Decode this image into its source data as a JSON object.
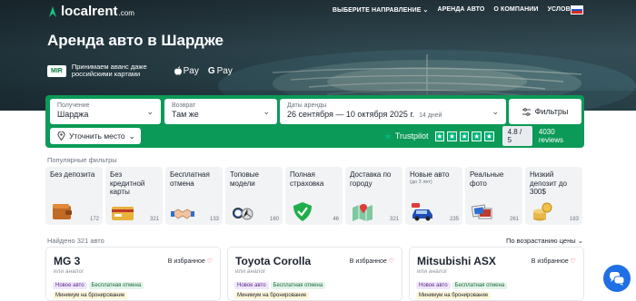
{
  "header": {
    "logo_text": "localrent",
    "logo_domain": ".com",
    "nav": [
      "ВЫБЕРИТЕ НАПРАВЛЕНИЕ ⌄",
      "АРЕНДА АВТО",
      "О КОМПАНИИ",
      "УСЛОВИЯ"
    ]
  },
  "hero": {
    "title": "Аренда авто в Шардже",
    "mir_label": "MIR",
    "payment_text_line1": "Принимаем аванс даже",
    "payment_text_line2": "российскими картами",
    "apple_pay": "Pay",
    "google_pay": "Pay"
  },
  "search": {
    "pickup_label": "Получение",
    "pickup_value": "Шарджа",
    "return_label": "Возврат",
    "return_value": "Там же",
    "dates_label": "Даты аренды",
    "dates_value": "26 сентября — 10 октября 2025 г.",
    "days": "14 дней",
    "filters_label": "Фильтры",
    "location_label": "Уточнить место",
    "trustpilot": "Trustpilot",
    "rating": "4.8 / 5",
    "reviews": "4030 reviews"
  },
  "popular": {
    "label": "Популярные фильтры",
    "items": [
      {
        "title": "Без депозита",
        "sub": "",
        "count": "172",
        "icon": "wallet-icon"
      },
      {
        "title": "Без кредитной карты",
        "sub": "",
        "count": "321",
        "icon": "card-icon"
      },
      {
        "title": "Бесплатная отмена",
        "sub": "",
        "count": "133",
        "icon": "handshake-icon"
      },
      {
        "title": "Топовые модели",
        "sub": "",
        "count": "160",
        "icon": "car-logos-icon"
      },
      {
        "title": "Полная страховка",
        "sub": "",
        "count": "46",
        "icon": "shield-icon"
      },
      {
        "title": "Доставка по городу",
        "sub": "",
        "count": "321",
        "icon": "map-icon"
      },
      {
        "title": "Новые авто",
        "sub": "(до 3 лет)",
        "count": "235",
        "icon": "new-car-icon"
      },
      {
        "title": "Реальные фото",
        "sub": "",
        "count": "261",
        "icon": "photos-icon"
      },
      {
        "title": "Низкий депозит до 300$",
        "sub": "",
        "count": "183",
        "icon": "coins-icon"
      }
    ]
  },
  "results": {
    "found": "Найдено 321 авто",
    "sort": "По возрастанию цены ⌄",
    "cards": [
      {
        "name": "MG 3",
        "analog": "или аналог",
        "fav": "В избранное",
        "badge1": "Новое авто",
        "badge2": "Бесплатная отмена",
        "extra": "Минимум на бронирование"
      },
      {
        "name": "Toyota Corolla",
        "analog": "или аналог",
        "fav": "В избранное",
        "badge1": "Новое авто",
        "badge2": "Бесплатная отмена",
        "extra": "Минимум на бронирование"
      },
      {
        "name": "Mitsubishi ASX",
        "analog": "или аналог",
        "fav": "В избранное",
        "badge1": "Новое авто",
        "badge2": "Бесплатная отмена",
        "extra": "Минимум на бронирование"
      }
    ]
  },
  "colors": {
    "brand_green": "#0b9a57",
    "trustpilot_green": "#00b67a",
    "chat_blue": "#1f6fe5"
  }
}
